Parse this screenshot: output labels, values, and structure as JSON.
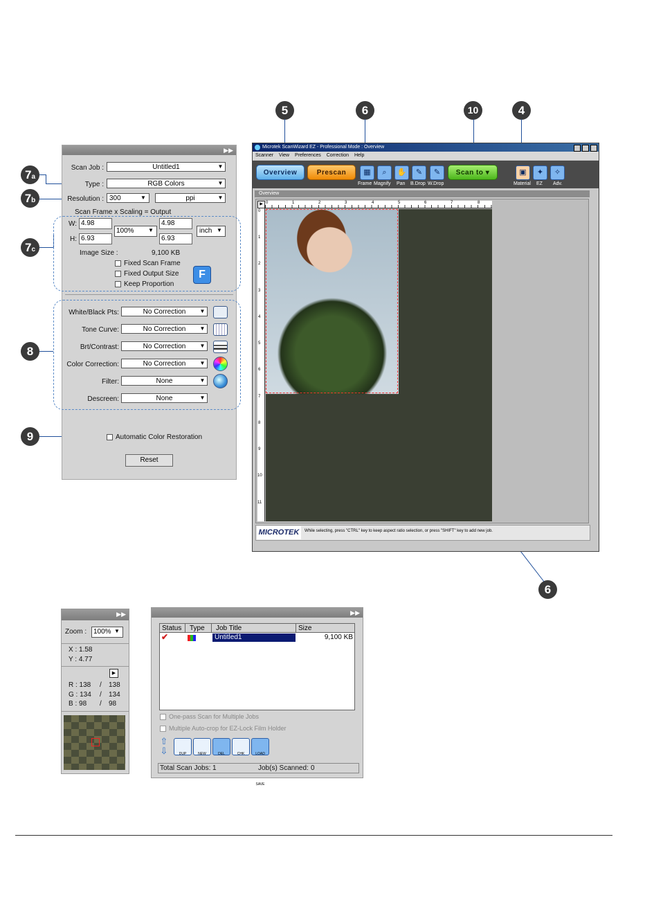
{
  "callouts": {
    "c5": "5",
    "c6": "6",
    "c10": "10",
    "c4": "4",
    "c7a": "7",
    "c7a_sub": "a",
    "c7b": "7",
    "c7b_sub": "b",
    "c7c": "7",
    "c7c_sub": "c",
    "c8": "8",
    "c9": "9",
    "c6b": "6"
  },
  "settings": {
    "scan_job_label": "Scan Job :",
    "scan_job_value": "Untitled1",
    "type_label": "Type :",
    "type_value": "RGB Colors",
    "resolution_label": "Resolution :",
    "resolution_value": "300",
    "resolution_unit": "ppi",
    "frame_header": "Scan Frame  x  Scaling  =  Output",
    "w_label": "W:",
    "w_value": "4.98",
    "h_label": "H:",
    "h_value": "6.93",
    "scaling_value": "100%",
    "out_w": "4.98",
    "out_h": "6.93",
    "unit_value": "inch",
    "image_size_label": "Image Size :",
    "image_size_value": "9,100 KB",
    "fixed_scan_frame": "Fixed Scan Frame",
    "fixed_output_size": "Fixed Output Size",
    "keep_proportion": "Keep Proportion",
    "f_button": "F",
    "white_black_label": "White/Black Pts:",
    "white_black_value": "No Correction",
    "tone_curve_label": "Tone Curve:",
    "tone_curve_value": "No Correction",
    "brt_contrast_label": "Brt/Contrast:",
    "brt_contrast_value": "No Correction",
    "color_correction_label": "Color Correction:",
    "color_correction_value": "No Correction",
    "filter_label": "Filter:",
    "filter_value": "None",
    "descreen_label": "Descreen:",
    "descreen_value": "None",
    "acr_label": "Automatic Color Restoration",
    "reset_label": "Reset"
  },
  "window": {
    "title": "Microtek ScanWizard EZ - Professional Mode : Overview",
    "menu": [
      "Scanner",
      "View",
      "Preferences",
      "Correction",
      "Help"
    ],
    "overview_btn": "Overview",
    "prescan_btn": "Prescan",
    "scanto_btn": "Scan to",
    "tool_labels": {
      "frame": "Frame",
      "magnify": "Magnify",
      "pan": "Pan",
      "bdrop": "B.Drop",
      "wdrop": "W.Drop",
      "material": "Material",
      "ez": "EZ",
      "adv": "Adv."
    },
    "panel_tab": "Overview",
    "ruler_numbers_x": [
      "0",
      "1",
      "2",
      "3",
      "4",
      "5",
      "6",
      "7",
      "8"
    ],
    "ruler_numbers_y": [
      "0",
      "1",
      "2",
      "3",
      "4",
      "5",
      "6",
      "7",
      "8",
      "9",
      "10",
      "11"
    ],
    "brand": "MICROTEK",
    "status_text": "While selecting, press \"CTRL\" key to keep aspect ratio selection, or press \"SHIFT\" key to add new job.",
    "colors": {
      "overview_btn": "#7cc2f2",
      "prescan_btn": "#f59a1c",
      "scanto_btn": "#5cc62e"
    }
  },
  "info": {
    "zoom_label": "Zoom :",
    "zoom_value": "100%",
    "x": "X : 1.58",
    "y": "Y : 4.77",
    "r": "R : 138",
    "r2": "138",
    "g": "G : 134",
    "g2": "134",
    "b": "B : 98",
    "b2": "98",
    "slash": "/"
  },
  "queue": {
    "columns": [
      "Status",
      "Type",
      "Job Title",
      "Size"
    ],
    "row": {
      "title": "Untitled1",
      "size": "9,100 KB"
    },
    "one_pass": "One-pass Scan for Multiple Jobs",
    "multiple_autocrop": "Multiple Auto-crop for EZ-Lock Film Holder",
    "tool_labels": [
      "DUP",
      "NEW",
      "DEL",
      "CHK",
      "LOAD SAVE"
    ],
    "total_label": "Total Scan Jobs:",
    "total_value": "1",
    "scanned_label": "Job(s) Scanned:",
    "scanned_value": "0"
  }
}
